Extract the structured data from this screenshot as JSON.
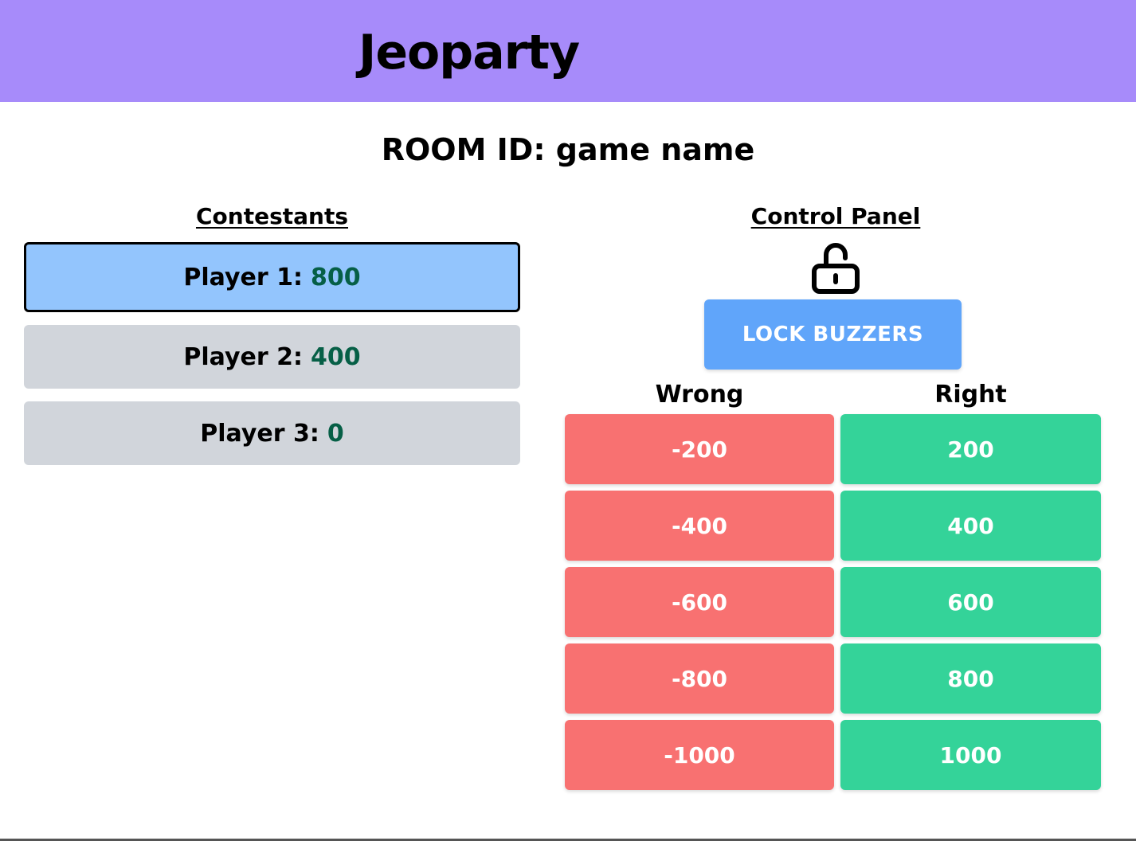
{
  "header": {
    "title": "Jeoparty"
  },
  "room": {
    "label": "ROOM ID: game name"
  },
  "contestants": {
    "title": "Contestants",
    "players": [
      {
        "name": "Player 1:",
        "score": "800",
        "active": true
      },
      {
        "name": "Player 2:",
        "score": "400",
        "active": false
      },
      {
        "name": "Player 3:",
        "score": "0",
        "active": false
      }
    ]
  },
  "control_panel": {
    "title": "Control Panel",
    "lock_icon": "unlocked-padlock-icon",
    "lock_button_label": "LOCK BUZZERS",
    "wrong_label": "Wrong",
    "right_label": "Right",
    "wrong_values": [
      "-200",
      "-400",
      "-600",
      "-800",
      "-1000"
    ],
    "right_values": [
      "200",
      "400",
      "600",
      "800",
      "1000"
    ]
  },
  "colors": {
    "header": "#a78bfa",
    "active_player": "#93c5fd",
    "inactive_player": "#d1d5db",
    "score_text": "#065f46",
    "lock_button": "#60a5fa",
    "wrong": "#f87171",
    "right": "#34d399"
  }
}
